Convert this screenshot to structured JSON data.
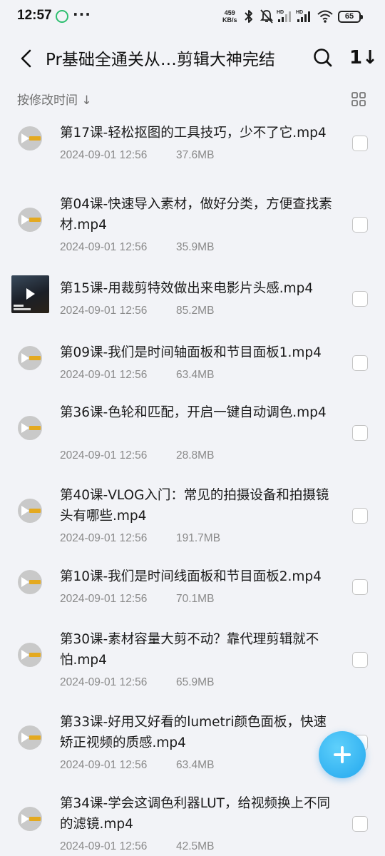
{
  "status_bar": {
    "time": "12:57",
    "dots": "···",
    "net_speed_value": "459",
    "net_speed_unit": "KB/s",
    "battery": "65"
  },
  "header": {
    "title": "Pr基础全通关从…剪辑大神完结",
    "sort_icon_text": "1↓"
  },
  "sort_bar": {
    "label": "按修改时间 ↓"
  },
  "files": [
    {
      "name": "第17课-轻松抠图的工具技巧，少不了它.mp4",
      "date": "2024-09-01 12:56",
      "size": "37.6MB",
      "thumb": "audio"
    },
    {
      "name": "第04课-快速导入素材，做好分类，方便查找素材.mp4",
      "date": "2024-09-01 12:56",
      "size": "35.9MB",
      "thumb": "audio"
    },
    {
      "name": "第15课-用裁剪特效做出来电影片头感.mp4",
      "date": "2024-09-01 12:56",
      "size": "85.2MB",
      "thumb": "video"
    },
    {
      "name": "第09课-我们是时间轴面板和节目面板1.mp4",
      "date": "2024-09-01 12:56",
      "size": "63.4MB",
      "thumb": "audio"
    },
    {
      "name": "第36课-色轮和匹配，开启一键自动调色.mp4",
      "date": "2024-09-01 12:56",
      "size": "28.8MB",
      "thumb": "audio"
    },
    {
      "name": "第40课-VLOG入门：常见的拍摄设备和拍摄镜头有哪些.mp4",
      "date": "2024-09-01 12:56",
      "size": "191.7MB",
      "thumb": "audio"
    },
    {
      "name": "第10课-我们是时间线面板和节目面板2.mp4",
      "date": "2024-09-01 12:56",
      "size": "70.1MB",
      "thumb": "audio"
    },
    {
      "name": "第30课-素材容量大剪不动？靠代理剪辑就不怕.mp4",
      "date": "2024-09-01 12:56",
      "size": "65.9MB",
      "thumb": "audio"
    },
    {
      "name": "第33课-好用又好看的lumetri颜色面板，快速矫正视频的质感.mp4",
      "date": "2024-09-01 12:56",
      "size": "63.4MB",
      "thumb": "audio"
    },
    {
      "name": "第34课-学会这调色利器LUT，给视频换上不同的滤镜.mp4",
      "date": "2024-09-01 12:56",
      "size": "42.5MB",
      "thumb": "audio"
    }
  ],
  "colors": {
    "background": "#f2f3f7",
    "fab": "#22a7ee",
    "secondary_text": "#8a8a8a"
  }
}
